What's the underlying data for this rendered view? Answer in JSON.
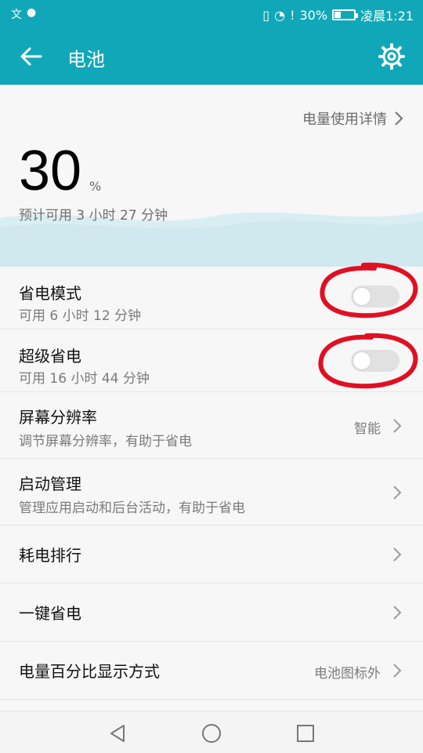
{
  "status_bar": {
    "left_icons": [
      "翻译图标",
      "微信图标"
    ],
    "battery_percent": "30%",
    "time": "凌晨1:21"
  },
  "app_bar": {
    "title": "电池"
  },
  "hero": {
    "detail_link": "电量使用详情",
    "battery_level": "30",
    "unit": "%",
    "estimate": "预计可用 3 小时 27 分钟"
  },
  "rows": {
    "power_saving": {
      "title": "省电模式",
      "sub": "可用 6 小时 12 分钟",
      "enabled": false
    },
    "ultra_saving": {
      "title": "超级省电",
      "sub": "可用 16 小时 44 分钟",
      "enabled": false
    },
    "resolution": {
      "title": "屏幕分辨率",
      "sub": "调节屏幕分辨率，有助于省电",
      "value": "智能"
    },
    "startup": {
      "title": "启动管理",
      "sub": "管理应用启动和后台活动，有助于省电"
    },
    "ranking": {
      "title": "耗电排行"
    },
    "one_click": {
      "title": "一键省电"
    },
    "percentage_display": {
      "title": "电量百分比显示方式",
      "value": "电池图标外"
    }
  },
  "colors": {
    "accent": "#10a8b8",
    "annotation": "#e01022"
  }
}
